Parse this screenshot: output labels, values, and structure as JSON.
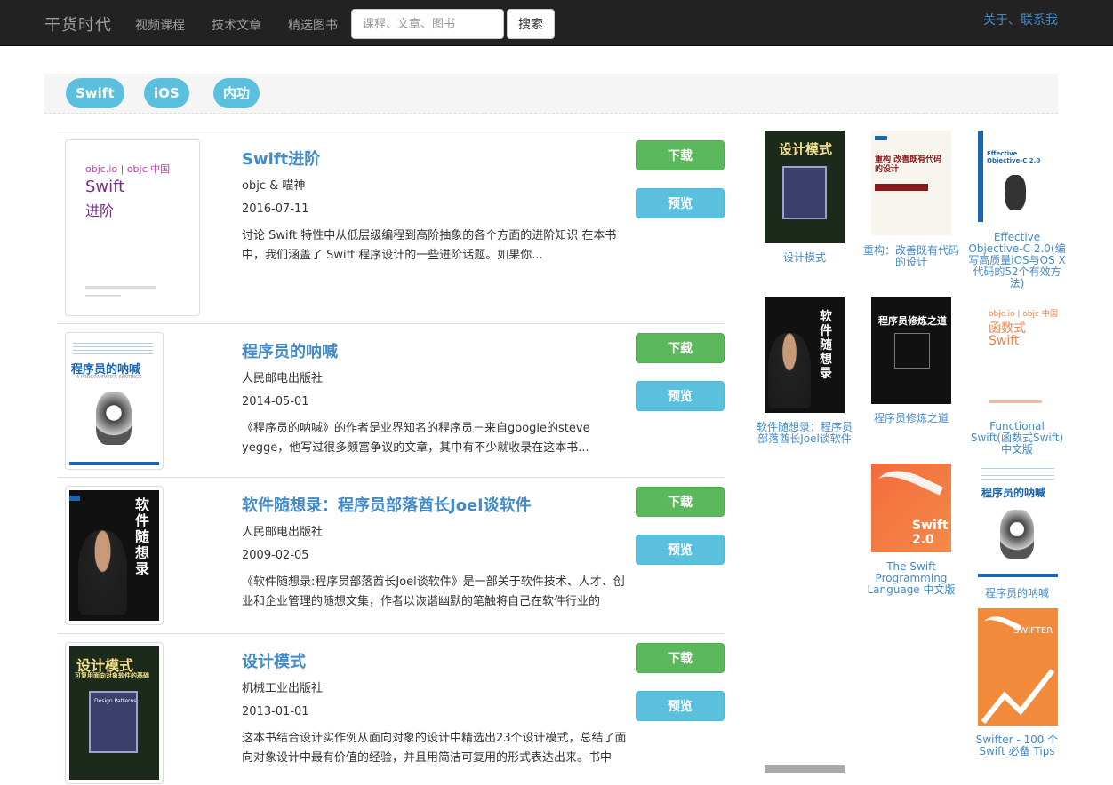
{
  "navbar": {
    "brand": "干货时代",
    "links": [
      "视频课程",
      "技术文章",
      "精选图书"
    ],
    "search_placeholder": "课程、文章、图书",
    "search_button": "搜索",
    "about": "关于、联系我"
  },
  "tags": [
    "Swift",
    "iOS",
    "内功"
  ],
  "books": [
    {
      "title": "Swift进阶",
      "author": "objc & 喵神",
      "date": "2016-07-11",
      "desc": "讨论 Swift 特性中从低层级编程到高阶抽象的各个方面的进阶知识 在本书中，我们涵盖了 Swift 程序设计的一些进阶话题。如果你...",
      "download": "下载",
      "preview": "预览",
      "cover_lines": [
        "objc.io | objc 中国",
        "Swift",
        "进阶"
      ]
    },
    {
      "title": "程序员的呐喊",
      "author": "人民邮电出版社",
      "date": "2014-05-01",
      "desc": "《程序员的呐喊》的作者是业界知名的程序员－来自google的steve yegge，他写过很多颇富争议的文章，其中有不少就收录在这本书...",
      "download": "下载",
      "preview": "预览",
      "cover_lines": [
        "程序员的呐喊",
        "A PROGRAMMER'S RANTINGS"
      ]
    },
    {
      "title": "软件随想录：程序员部落酋长Joel谈软件",
      "author": "人民邮电出版社",
      "date": "2009-02-05",
      "desc": "《软件随想录:程序员部落酋长Joel谈软件》是一部关于软件技术、人才、创业和企业管理的随想文集，作者以诙谐幽默的笔触将自己在软件行业的",
      "download": "下载",
      "preview": "预览",
      "cover_lines": [
        "软件随想录"
      ]
    },
    {
      "title": "设计模式",
      "author": "机械工业出版社",
      "date": "2013-01-01",
      "desc": "这本书结合设计实作例从面向对象的设计中精选出23个设计模式，总结了面向对象设计中最有价值的经验，并且用简洁可复用的形式表达出来。书中",
      "download": "下载",
      "preview": "预览",
      "cover_lines": [
        "设计模式",
        "可复用面向对象软件的基础",
        "Design Patterns"
      ]
    }
  ],
  "sidebar": {
    "col1": [
      {
        "caption": "设计模式",
        "cover": "设计模式"
      },
      {
        "caption": "软件随想录：程序员部落酋长Joel谈软件",
        "cover": "软件随想录"
      }
    ],
    "col2": [
      {
        "caption": "重构：改善既有代码的设计",
        "cover": "重构 改善既有代码的设计"
      },
      {
        "caption": "程序员修炼之道",
        "cover": "程序员修炼之道"
      },
      {
        "caption": "The Swift Programming Language 中文版",
        "cover": "Swift 2.0"
      }
    ],
    "col3": [
      {
        "caption": "Effective Objective-C 2.0(编写高质量iOS与OS X代码的52个有效方法)",
        "cover": "Effective Objective-C 2.0"
      },
      {
        "caption": "Functional Swift(函数式Swift)中文版",
        "cover_lines": [
          "objc.io | objc 中国",
          "函数式",
          "Swift"
        ]
      },
      {
        "caption": "程序员的呐喊",
        "cover": "程序员的呐喊"
      },
      {
        "caption": "Swifter - 100 个 Swift 必备 Tips",
        "cover": "SWIFTER"
      }
    ]
  },
  "colors": {
    "navbar_bg": "#222222",
    "link": "#428bca",
    "tag": "#5bc0de",
    "download": "#5cb85c",
    "preview": "#5bc0de"
  }
}
